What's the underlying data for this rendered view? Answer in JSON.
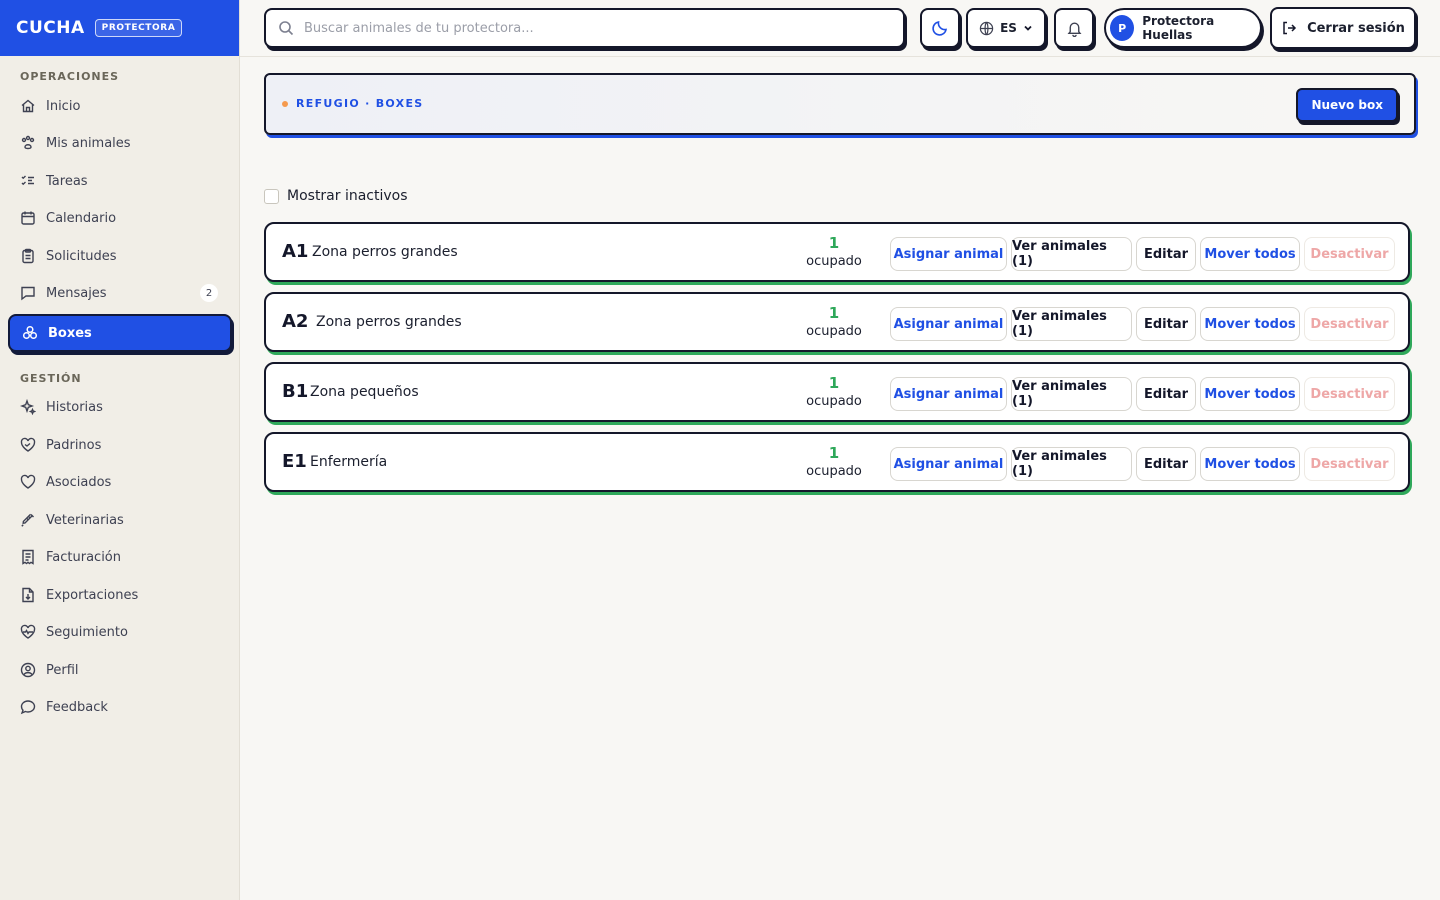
{
  "brand": {
    "name": "CUCHA",
    "badge": "PROTECTORA"
  },
  "sidebar": {
    "sections": [
      {
        "title": "OPERACIONES",
        "items": [
          {
            "label": "Inicio",
            "icon": "home-icon"
          },
          {
            "label": "Mis animales",
            "icon": "paw-icon"
          },
          {
            "label": "Tareas",
            "icon": "checklist-icon"
          },
          {
            "label": "Calendario",
            "icon": "calendar-icon"
          },
          {
            "label": "Solicitudes",
            "icon": "clipboard-icon"
          },
          {
            "label": "Mensajes",
            "icon": "message-icon",
            "count": "2"
          },
          {
            "label": "Boxes",
            "icon": "boxes-icon",
            "active": true
          }
        ]
      },
      {
        "title": "GESTIÓN",
        "items": [
          {
            "label": "Historias",
            "icon": "sparkles-icon"
          },
          {
            "label": "Padrinos",
            "icon": "heart-handshake-icon"
          },
          {
            "label": "Asociados",
            "icon": "heart-icon"
          },
          {
            "label": "Veterinarias",
            "icon": "syringe-icon"
          },
          {
            "label": "Facturación",
            "icon": "receipt-icon"
          },
          {
            "label": "Exportaciones",
            "icon": "file-download-icon"
          },
          {
            "label": "Seguimiento",
            "icon": "heart-pulse-icon"
          },
          {
            "label": "Perfil",
            "icon": "user-circle-icon"
          },
          {
            "label": "Feedback",
            "icon": "chat-bubble-icon"
          }
        ]
      }
    ]
  },
  "topbar": {
    "search_placeholder": "Buscar animales de tu protectora...",
    "language": "ES",
    "user_initial": "P",
    "user_name": "Protectora Huellas",
    "logout": "Cerrar sesión"
  },
  "header": {
    "breadcrumb": "REFUGIO · BOXES",
    "new_button": "Nuevo box"
  },
  "filter": {
    "show_inactive": "Mostrar inactivos"
  },
  "boxes": [
    {
      "code": "A1",
      "name": "Zona perros grandes",
      "count": "1",
      "count_label": "ocupado"
    },
    {
      "code": "A2",
      "name": "Zona perros grandes",
      "count": "1",
      "count_label": "ocupado"
    },
    {
      "code": "B1",
      "name": "Zona pequeños",
      "count": "1",
      "count_label": "ocupado"
    },
    {
      "code": "E1",
      "name": "Enfermería",
      "count": "1",
      "count_label": "ocupado"
    }
  ],
  "box_actions": {
    "assign": "Asignar animal",
    "view": "Ver animales (1)",
    "edit": "Editar",
    "move_all": "Mover todos",
    "deactivate": "Desactivar"
  },
  "colors": {
    "accent": "#2050e4",
    "success": "#2fa85a",
    "danger_muted": "#eea7a7",
    "ink": "#14172a"
  }
}
